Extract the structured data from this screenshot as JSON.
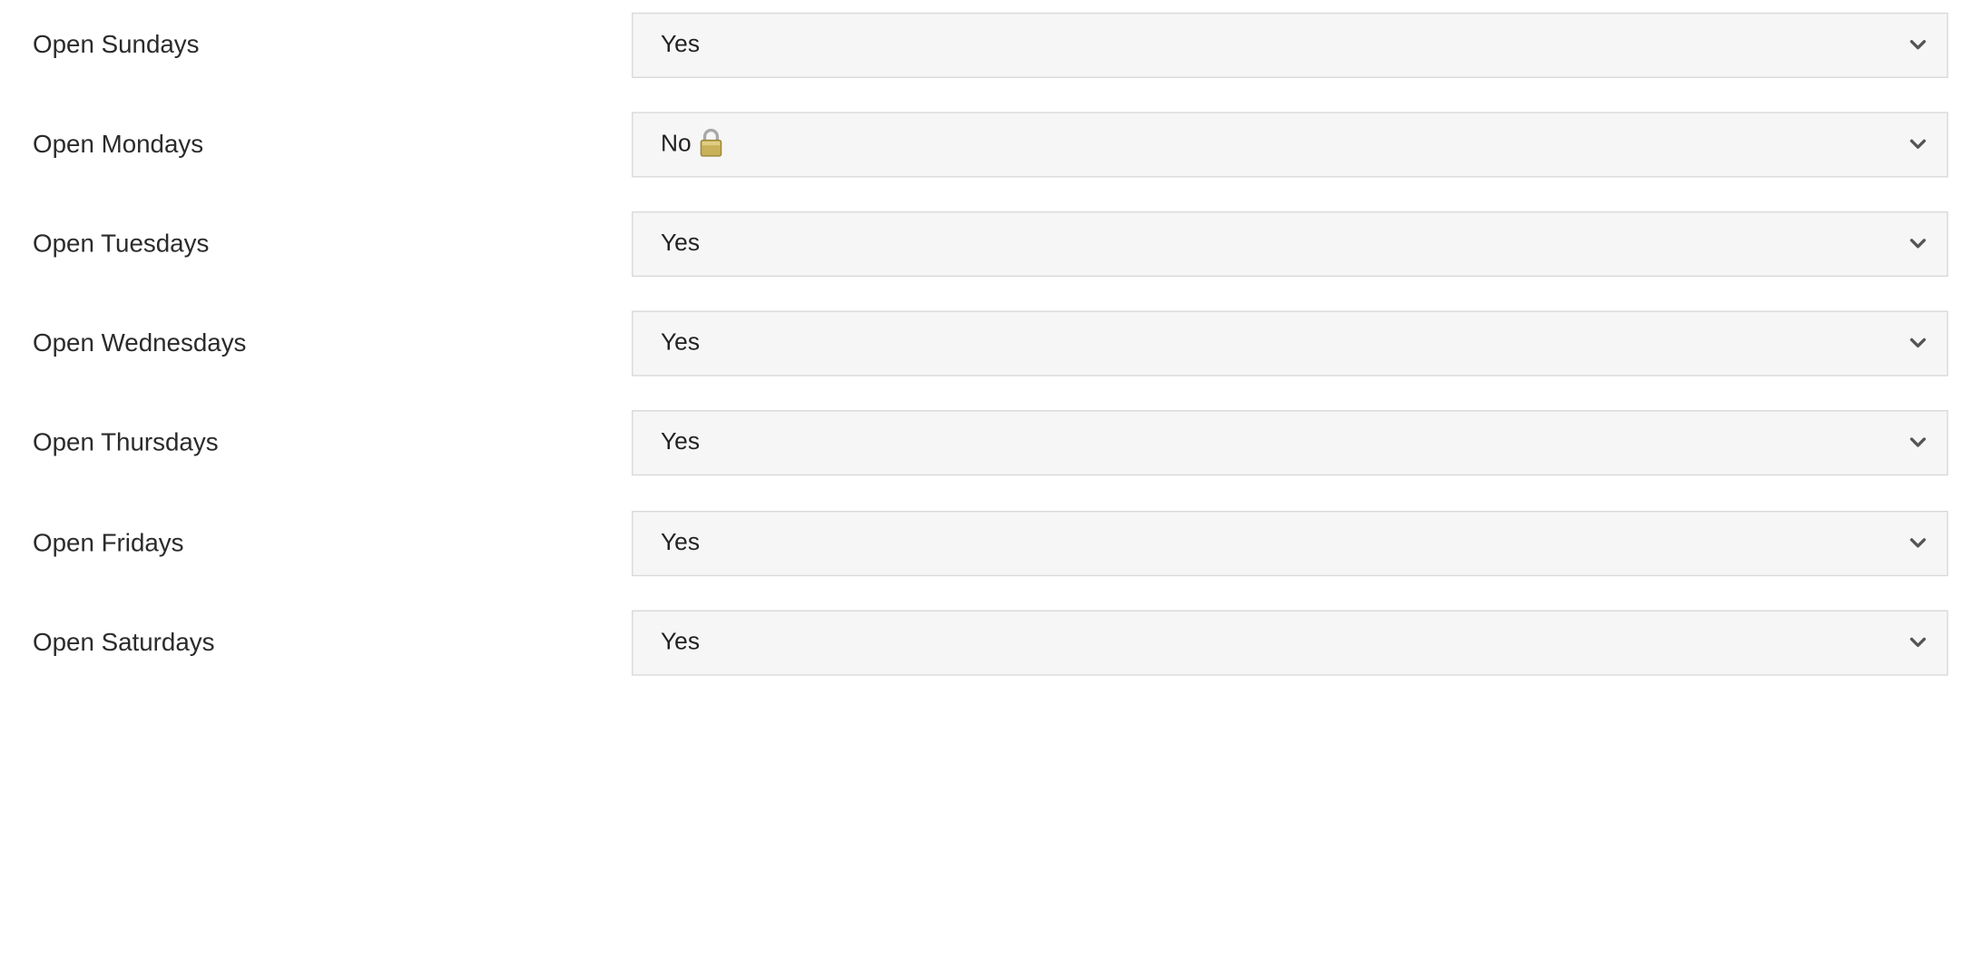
{
  "fields": [
    {
      "label": "Open Sundays",
      "value": "Yes",
      "locked": false
    },
    {
      "label": "Open Mondays",
      "value": "No",
      "locked": true
    },
    {
      "label": "Open Tuesdays",
      "value": "Yes",
      "locked": false
    },
    {
      "label": "Open Wednesdays",
      "value": "Yes",
      "locked": false
    },
    {
      "label": "Open Thursdays",
      "value": "Yes",
      "locked": false
    },
    {
      "label": "Open Fridays",
      "value": "Yes",
      "locked": false
    },
    {
      "label": "Open Saturdays",
      "value": "Yes",
      "locked": false
    }
  ],
  "icons": {
    "dropdown": "chevron-down-icon",
    "locked": "lock-icon"
  },
  "colors": {
    "select_background": "#f6f6f6",
    "select_border": "#d9d9d9",
    "label_text": "#2b2b2b",
    "chevron": "#555555",
    "lock_gold": "#c9b15a"
  }
}
